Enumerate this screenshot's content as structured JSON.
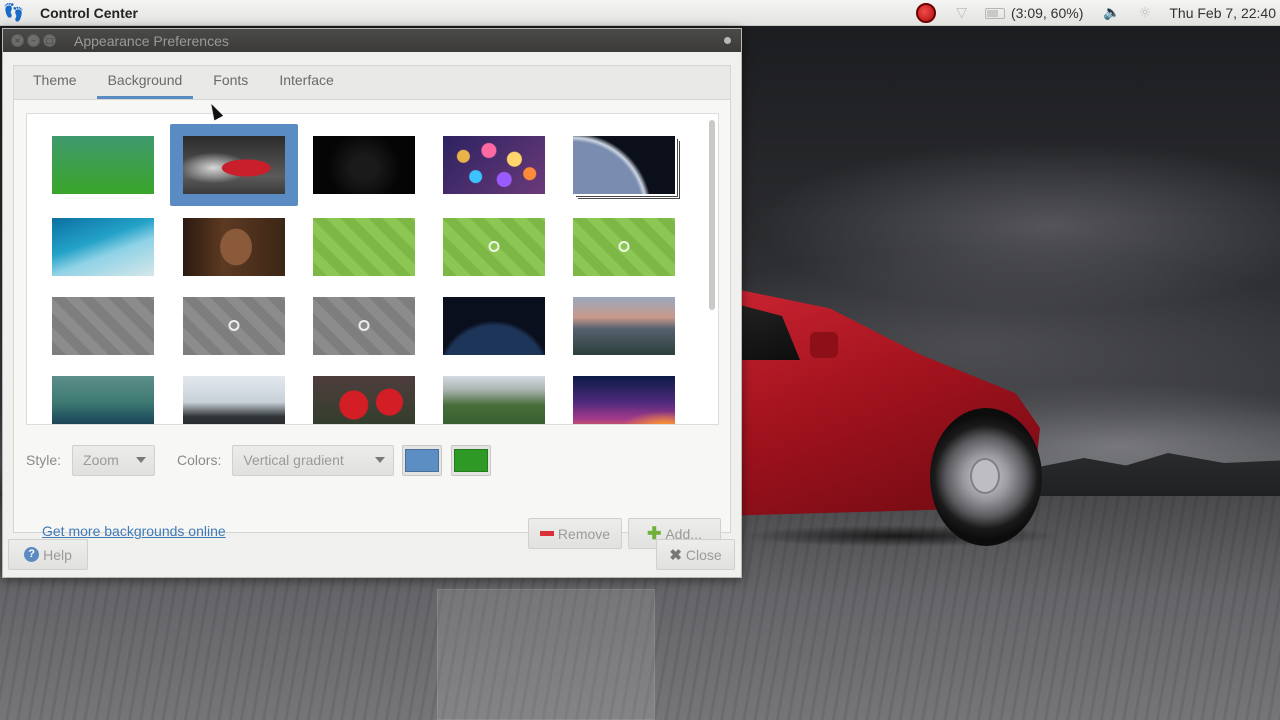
{
  "panel": {
    "app_name": "Control Center",
    "battery_text": "(3:09, 60%)",
    "clock": "Thu Feb 7, 22:40",
    "logo_icon": "gnome-foot-icon",
    "record_color": "#d21a1a"
  },
  "window": {
    "title": "Appearance Preferences",
    "tabs": [
      {
        "label": "Theme"
      },
      {
        "label": "Background"
      },
      {
        "label": "Fonts"
      },
      {
        "label": "Interface"
      }
    ],
    "active_tab": "Background",
    "accent_color": "#5a8bc2",
    "style_label": "Style:",
    "style_value": "Zoom",
    "colors_label": "Colors:",
    "colors_value": "Vertical gradient",
    "primary_color": "#5c8dc3",
    "secondary_color": "#2e9a25",
    "more_link": "Get more backgrounds online",
    "remove_label": "Remove",
    "add_label": "Add...",
    "help_label": "Help",
    "close_label": "Close"
  },
  "wallpapers": [
    {
      "name": "green-gradient",
      "selected": false
    },
    {
      "name": "red-car-smoke",
      "selected": true
    },
    {
      "name": "black-dark",
      "selected": false
    },
    {
      "name": "bokeh-lights",
      "selected": false
    },
    {
      "name": "earth-from-space",
      "selected": false
    },
    {
      "name": "ocean-shore",
      "selected": false
    },
    {
      "name": "woman-portrait",
      "selected": false
    },
    {
      "name": "green-mate-plain",
      "selected": false
    },
    {
      "name": "green-mate-logo-text",
      "selected": false
    },
    {
      "name": "green-mate-logo",
      "selected": false
    },
    {
      "name": "gray-mate-plain",
      "selected": false
    },
    {
      "name": "gray-mate-logo-text",
      "selected": false
    },
    {
      "name": "gray-mate-logo",
      "selected": false
    },
    {
      "name": "earth-night-lights",
      "selected": false
    },
    {
      "name": "yosemite-valley",
      "selected": false
    },
    {
      "name": "teal-rain-bokeh",
      "selected": false
    },
    {
      "name": "misty-mountain",
      "selected": false
    },
    {
      "name": "football-players",
      "selected": false
    },
    {
      "name": "green-cliffs",
      "selected": false
    },
    {
      "name": "purple-sunset",
      "selected": false
    }
  ]
}
